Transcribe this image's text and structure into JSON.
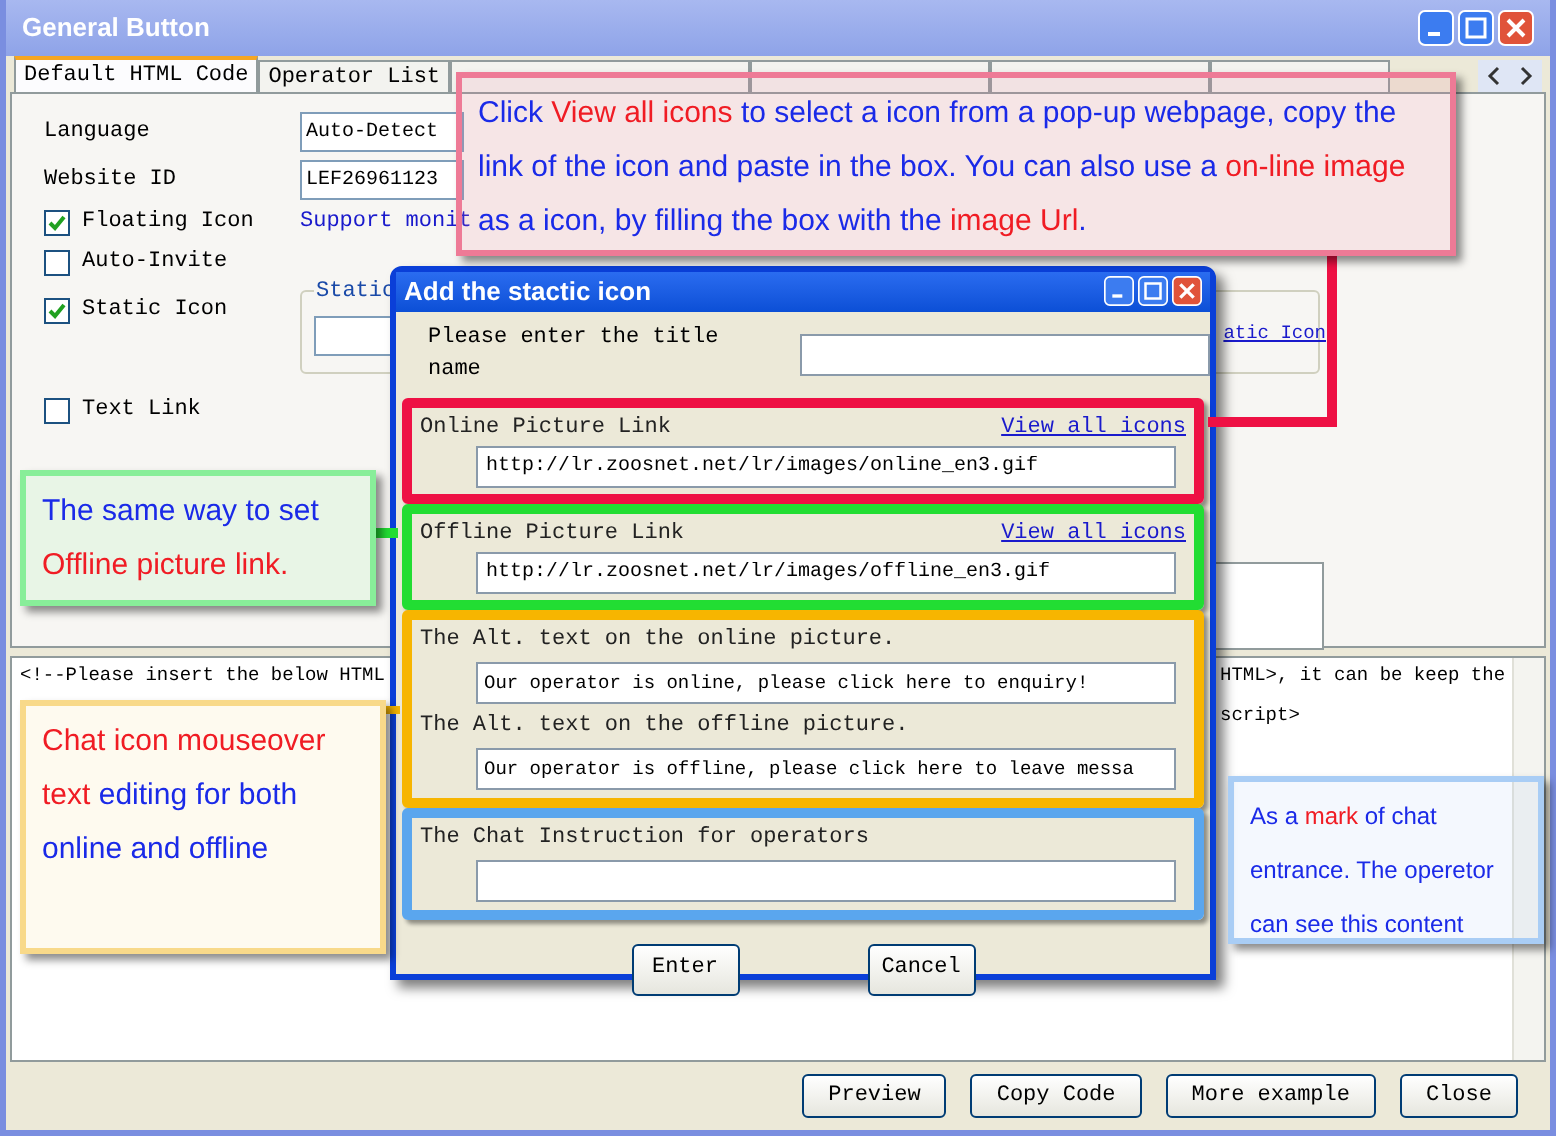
{
  "window": {
    "title": "General Button"
  },
  "tabs": [
    {
      "label": "Default HTML Code",
      "selected": true
    },
    {
      "label": "Operator List",
      "selected": false
    }
  ],
  "form": {
    "language": {
      "label": "Language",
      "value": "Auto-Detect"
    },
    "website_id": {
      "label": "Website ID",
      "value": "LEF26961123"
    },
    "checkboxes": [
      {
        "label": "Floating Icon",
        "checked": true,
        "note": "Support monit"
      },
      {
        "label": "Auto-Invite",
        "checked": false
      },
      {
        "label": "Static Icon",
        "checked": true
      },
      {
        "label": "Text Link",
        "checked": false
      }
    ],
    "static_group": {
      "legend": "Static",
      "link": "atic Icon"
    }
  },
  "code": {
    "left_line": "<!--Please insert the below HTML",
    "right_lines": [
      "HTML>, it can be keep the",
      "script>"
    ]
  },
  "buttons": [
    "Preview",
    "Copy Code",
    "More example",
    "Close"
  ],
  "dialog": {
    "title": "Add the stactic icon",
    "prompt": "Please enter the title name",
    "sections": [
      {
        "kind": "link-field",
        "color": "#ee1144",
        "label": "Online Picture Link",
        "link": "View all icons",
        "value": "http://lr.zoosnet.net/lr/images/online_en3.gif"
      },
      {
        "kind": "link-field",
        "color": "#22dd33",
        "label": "Offline Picture Link",
        "link": "View all icons",
        "value": "http://lr.zoosnet.net/lr/images/offline_en3.gif"
      },
      {
        "kind": "text-pair",
        "color": "#f7b500",
        "items": [
          {
            "label": "The Alt. text on the online picture.",
            "value": "Our operator is online, please click here to enquiry!"
          },
          {
            "label": "The Alt. text on the offline picture.",
            "value": "Our operator is offline, please click here to leave messa"
          }
        ]
      },
      {
        "kind": "text-pair",
        "color": "#5aa6ee",
        "items": [
          {
            "label": "The Chat Instruction for operators"
          }
        ]
      }
    ],
    "buttons": [
      "Enter",
      "Cancel"
    ]
  },
  "callouts": [
    {
      "color": "#ee7a96",
      "segments": [
        {
          "text": "Click ",
          "highlight": false
        },
        {
          "text": "View all icons",
          "highlight": true
        },
        {
          "text": " to select a icon from a pop-up webpage, copy the link of the icon and paste in the box. You can also use a ",
          "highlight": false
        },
        {
          "text": "on-line image",
          "highlight": true
        },
        {
          "text": " as a icon, by filling the box with the ",
          "highlight": false
        },
        {
          "text": "image Url",
          "highlight": true
        },
        {
          "text": ".",
          "highlight": false
        }
      ]
    },
    {
      "color": "#88ee99",
      "segments": [
        {
          "text": "The same way to set ",
          "highlight": false
        },
        {
          "text": "Offline picture link.",
          "highlight": true
        }
      ]
    },
    {
      "color": "#f8d98a",
      "segments": [
        {
          "text": "Chat icon mouseover text",
          "highlight": true
        },
        {
          "text": " editing for both online and offline",
          "highlight": false
        }
      ]
    },
    {
      "color": "#a9cdf5",
      "segments": [
        {
          "text": "As a ",
          "highlight": false
        },
        {
          "text": "mark",
          "highlight": true
        },
        {
          "text": " of chat entrance. The operetor can see this content",
          "highlight": false
        }
      ]
    }
  ]
}
